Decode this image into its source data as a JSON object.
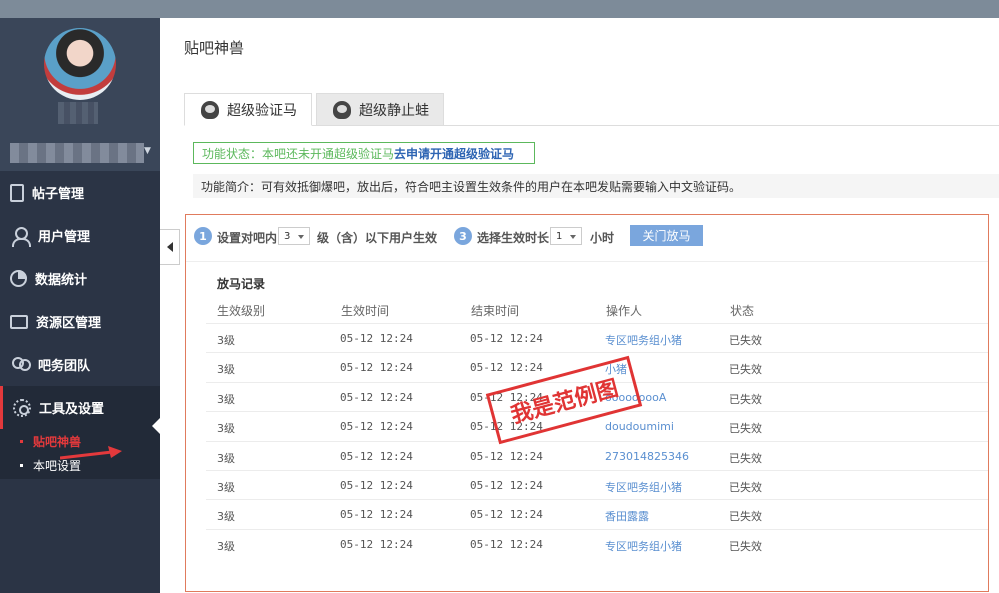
{
  "sidebar": {
    "nav": [
      {
        "label": "帖子管理",
        "icon": "document-icon"
      },
      {
        "label": "用户管理",
        "icon": "user-icon"
      },
      {
        "label": "数据统计",
        "icon": "pie-chart-icon"
      },
      {
        "label": "资源区管理",
        "icon": "folder-icon"
      },
      {
        "label": "吧务团队",
        "icon": "team-icon"
      },
      {
        "label": "工具及设置",
        "icon": "gear-icon"
      }
    ],
    "submenu": [
      {
        "label": "贴吧神兽"
      },
      {
        "label": "本吧设置"
      }
    ]
  },
  "page": {
    "title": "贴吧神兽"
  },
  "tabs": [
    {
      "label": "超级验证马"
    },
    {
      "label": "超级静止蛙"
    }
  ],
  "status": {
    "text": "功能状态：本吧还未开通超级验证马",
    "link": "去申请开通超级验证马"
  },
  "intro": {
    "text": "功能简介：可有效抵御爆吧，放出后，符合吧主设置生效条件的用户在本吧发贴需要输入中文验证码。"
  },
  "settings": {
    "step1": {
      "num": "1",
      "label": "设置对吧内",
      "value": "3",
      "suffix": "级（含）以下用户生效"
    },
    "step3": {
      "num": "3",
      "label": "选择生效时长",
      "value": "1",
      "suffix": "小时"
    },
    "button": "关门放马"
  },
  "records": {
    "title": "放马记录",
    "headers": [
      "生效级别",
      "生效时间",
      "结束时间",
      "操作人",
      "状态"
    ],
    "rows": [
      {
        "level": "3级",
        "start": "05-12  12:24",
        "end": "05-12  12:24",
        "operator": "专区吧务组小猪",
        "status": "已失效"
      },
      {
        "level": "3级",
        "start": "05-12  12:24",
        "end": "05-12  12:24",
        "operator": "小猪",
        "status": "已失效"
      },
      {
        "level": "3级",
        "start": "05-12  12:24",
        "end": "05-12  12:24",
        "operator": "ooooooooA",
        "status": "已失效"
      },
      {
        "level": "3级",
        "start": "05-12  12:24",
        "end": "05-12  12:24",
        "operator": "doudoumimi",
        "status": "已失效"
      },
      {
        "level": "3级",
        "start": "05-12  12:24",
        "end": "05-12  12:24",
        "operator": "273014825346",
        "status": "已失效"
      },
      {
        "level": "3级",
        "start": "05-12  12:24",
        "end": "05-12  12:24",
        "operator": "专区吧务组小猪",
        "status": "已失效"
      },
      {
        "level": "3级",
        "start": "05-12  12:24",
        "end": "05-12  12:24",
        "operator": "香田露露",
        "status": "已失效"
      },
      {
        "level": "3级",
        "start": "05-12  12:24",
        "end": "05-12  12:24",
        "operator": "专区吧务组小猪",
        "status": "已失效"
      }
    ]
  },
  "stamp": {
    "text": "我是范例图"
  },
  "colors": {
    "sidebar": "#2b3445",
    "accent_red": "#e3393c",
    "link_blue": "#5a8fd0",
    "status_green": "#5cb85c",
    "panel_border": "#e07b5d"
  }
}
